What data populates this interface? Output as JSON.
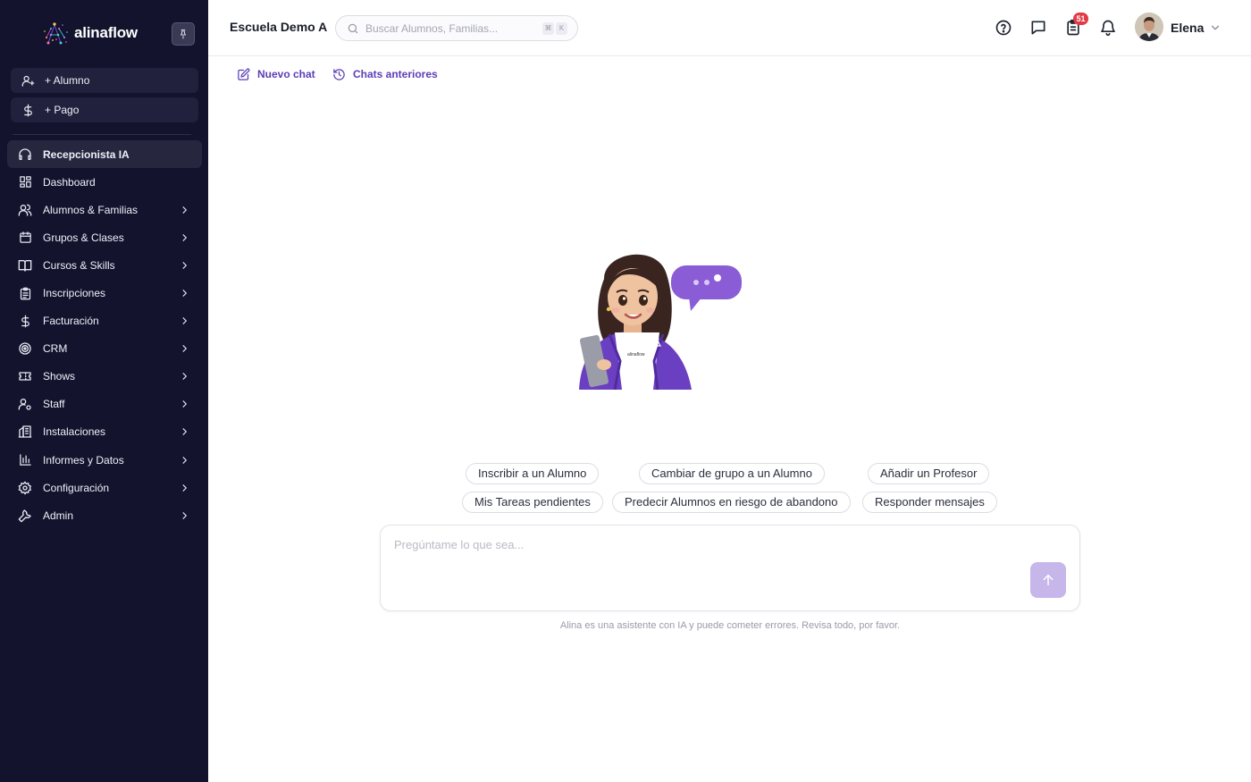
{
  "sidebar": {
    "logo_text": "alinaflow",
    "quick_actions": [
      {
        "label": "+ Alumno",
        "icon": "user-plus-icon"
      },
      {
        "label": "+ Pago",
        "icon": "dollar-icon"
      }
    ],
    "nav": [
      {
        "label": "Recepcionista IA",
        "icon": "headset-icon",
        "active": true,
        "has_children": false
      },
      {
        "label": "Dashboard",
        "icon": "dashboard-icon",
        "has_children": false
      },
      {
        "label": "Alumnos & Familias",
        "icon": "users-icon",
        "has_children": true
      },
      {
        "label": "Grupos & Clases",
        "icon": "calendar-icon",
        "has_children": true
      },
      {
        "label": "Cursos & Skills",
        "icon": "book-icon",
        "has_children": true
      },
      {
        "label": "Inscripciones",
        "icon": "clipboard-icon",
        "has_children": true
      },
      {
        "label": "Facturación",
        "icon": "dollar-icon",
        "has_children": true
      },
      {
        "label": "CRM",
        "icon": "target-icon",
        "has_children": true
      },
      {
        "label": "Shows",
        "icon": "ticket-icon",
        "has_children": true
      },
      {
        "label": "Staff",
        "icon": "user-gear-icon",
        "has_children": true
      },
      {
        "label": "Instalaciones",
        "icon": "building-icon",
        "has_children": true
      },
      {
        "label": "Informes y Datos",
        "icon": "bar-chart-icon",
        "has_children": true
      },
      {
        "label": "Configuración",
        "icon": "gear-icon",
        "has_children": true
      },
      {
        "label": "Admin",
        "icon": "wrench-icon",
        "has_children": true
      }
    ]
  },
  "header": {
    "school_name": "Escuela Demo A",
    "search_placeholder": "Buscar Alumnos, Familias...",
    "shortcut_keys": [
      "⌘",
      "K"
    ],
    "tasks_badge": "51",
    "user_name": "Elena"
  },
  "toolbar": {
    "new_chat": "Nuevo chat",
    "history": "Chats anteriores"
  },
  "suggestions": [
    "Inscribir a un Alumno",
    "Cambiar de grupo a un Alumno",
    "Añadir un Profesor",
    "Mis Tareas pendientes",
    "Predecir Alumnos en riesgo de abandono",
    "Responder mensajes"
  ],
  "composer": {
    "placeholder": "Pregúntame lo que sea...",
    "disclaimer": "Alina es una asistente con IA y puede cometer errores. Revisa todo, por favor."
  },
  "colors": {
    "sidebar_bg": "#13132e",
    "accent": "#5c3db8",
    "send_button": "#c6b6ea",
    "badge": "#e23a46"
  }
}
